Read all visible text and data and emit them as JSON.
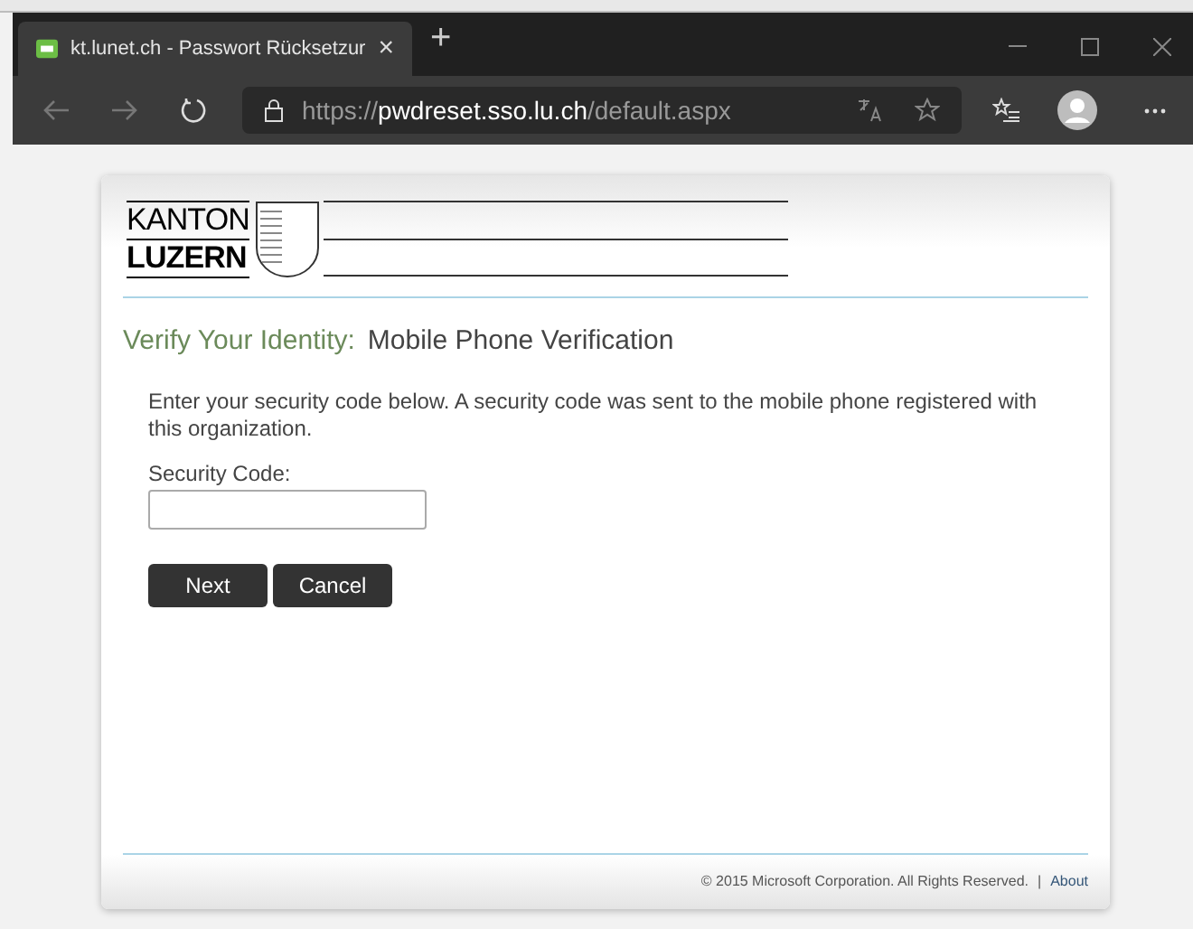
{
  "browser": {
    "tab": {
      "title": "kt.lunet.ch - Passwort Rücksetzur",
      "close": "×"
    },
    "new_tab": "+",
    "url": {
      "scheme": "https://",
      "host": "pwdreset.sso.lu.ch",
      "path": "/default.aspx"
    }
  },
  "logo": {
    "line_1": "KANTON",
    "line_2": "LUZERN"
  },
  "heading": {
    "prefix": "Verify Your Identity:",
    "title": "Mobile Phone Verification"
  },
  "instructions": "Enter your security code below. A security code was sent to the mobile phone registered with this organization.",
  "field": {
    "label": "Security Code:"
  },
  "buttons": [
    "Next",
    "Cancel"
  ],
  "footer": {
    "copyright": "© 2015 Microsoft Corporation. All Rights Reserved.",
    "separator": "|",
    "link": "About"
  }
}
